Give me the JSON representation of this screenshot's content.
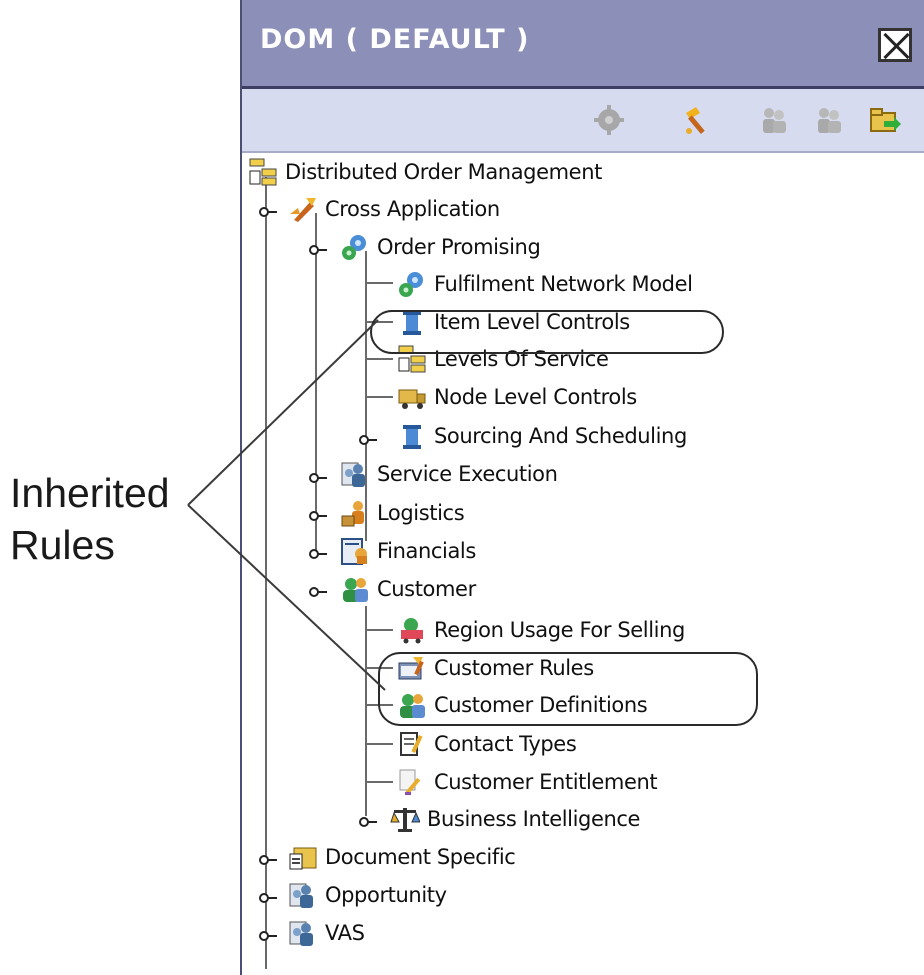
{
  "window": {
    "title": "DOM ( DEFAULT )",
    "close_icon": "close-icon"
  },
  "toolbar": {
    "buttons": [
      {
        "icon": "gear-disabled-icon"
      },
      {
        "icon": "rule-hammer-icon"
      },
      {
        "icon": "people-disabled-icon"
      },
      {
        "icon": "people-disabled-icon"
      },
      {
        "icon": "folder-arrow-icon"
      }
    ]
  },
  "tree": {
    "root": "Distributed Order Management",
    "cross_application": "Cross Application",
    "order_promising": "Order Promising",
    "fulfillment_network_model": "Fulfilment Network Model",
    "item_level_controls": "Item Level Controls",
    "levels_of_service": "Levels Of Service",
    "node_level_controls": "Node Level Controls",
    "sourcing_and_scheduling": "Sourcing And Scheduling",
    "service_execution": "Service Execution",
    "logistics": "Logistics",
    "financials": "Financials",
    "customer": "Customer",
    "region_usage_for_selling": "Region Usage For Selling",
    "customer_rules": "Customer Rules",
    "customer_definitions": "Customer Definitions",
    "contact_types": "Contact Types",
    "customer_entitlement": "Customer Entitlement",
    "business_intelligence": "Business Intelligence",
    "document_specific": "Document Specific",
    "opportunity": "Opportunity",
    "vas": "VAS"
  },
  "annotation": {
    "line1": "Inherited",
    "line2": "Rules"
  }
}
